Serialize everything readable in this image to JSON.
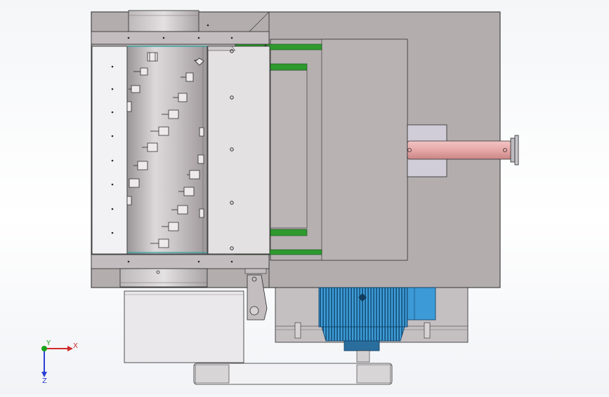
{
  "viewport": {
    "background": "#ffffff",
    "model_fill": "#b3adae",
    "model_stroke": "#2a2a2a",
    "rotor_fill": "#c9c4c6",
    "screen_fill": "#f2f2f4",
    "guide_rail_color": "#2e9a2e",
    "motor_color": "#3c9ad6",
    "shaft_color": "#e7a8a8"
  },
  "triad": {
    "x_label": "X",
    "y_label": "Y",
    "z_label": "Z",
    "x_color": "#d12a2a",
    "y_color": "#1aa31a",
    "z_color": "#2a3fd6"
  }
}
